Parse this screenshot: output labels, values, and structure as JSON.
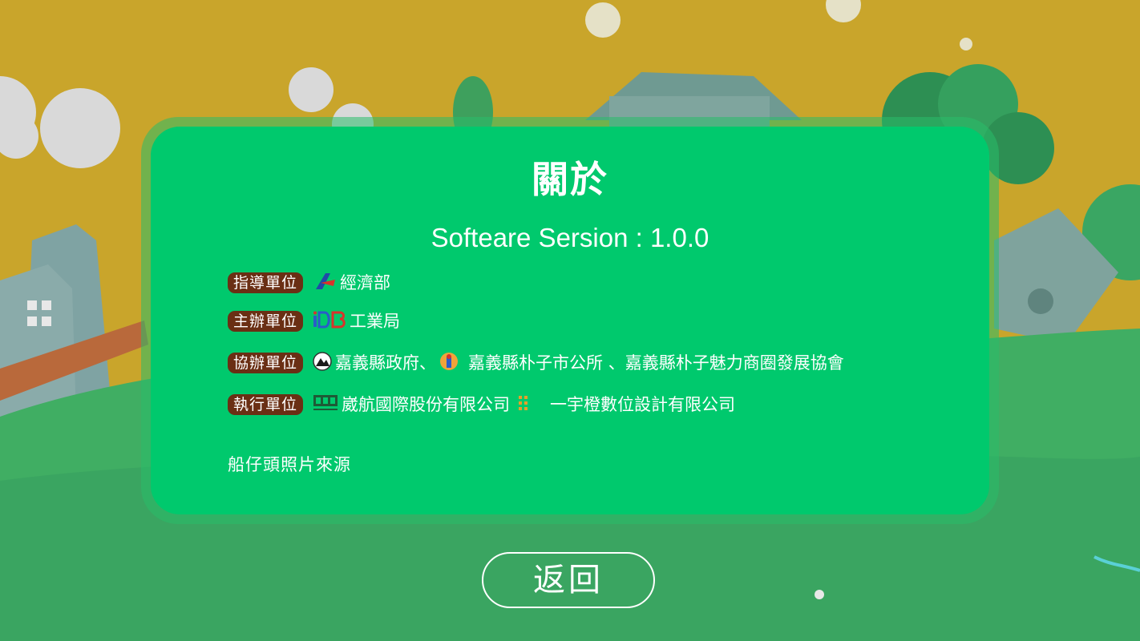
{
  "dialog": {
    "title": "關於",
    "version": "Softeare Sersion : 1.0.0",
    "rows": [
      {
        "badge": "指導單位",
        "orgs": [
          "經濟部"
        ]
      },
      {
        "badge": "主辦單位",
        "orgs": [
          "工業局"
        ]
      },
      {
        "badge": "協辦單位",
        "orgs": [
          "嘉義縣政府、",
          "嘉義縣朴子市公所 、嘉義縣朴子魅力商圈發展協會"
        ]
      },
      {
        "badge": "執行單位",
        "orgs": [
          "崴航國際股份有限公司",
          "一宇橙數位設計有限公司"
        ]
      }
    ],
    "photo_source": "船仔頭照片來源"
  },
  "back_button": {
    "label": "返回"
  },
  "logos": {
    "moea": "moea-logo-icon",
    "idb": "idb-logo-icon",
    "chiayi": "chiayi-county-logo-icon",
    "puzi": "puzi-city-logo-icon",
    "weihang": "weihang-logo-icon",
    "yiyu": "yiyu-logo-icon"
  },
  "colors": {
    "sky": "#c9a52b",
    "grass": "#3fae62",
    "dialog": "#00c96d",
    "badge": "#6a2f14",
    "text": "#ffffff"
  }
}
